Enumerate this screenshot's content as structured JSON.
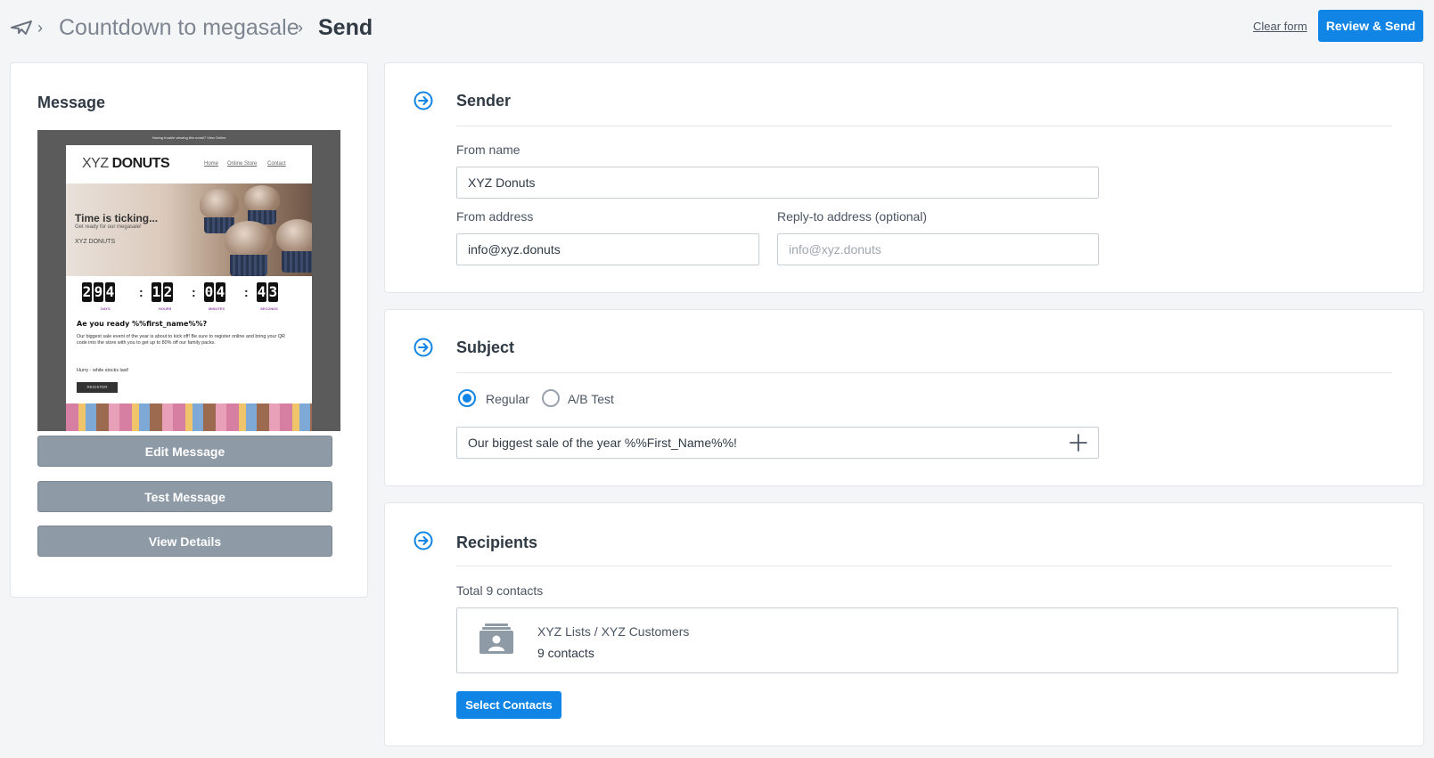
{
  "breadcrumb": {
    "parent": "Countdown to megasale",
    "current": "Send"
  },
  "header": {
    "clear_form": "Clear form",
    "review_send": "Review & Send"
  },
  "message": {
    "title": "Message",
    "preview": {
      "top_note": "Having trouble viewing this email? View Online",
      "logo_left": "XYZ ",
      "logo_right": "DONUTS",
      "nav": [
        "Home",
        "Online Store",
        "Contact"
      ],
      "hero_title": "Time is ticking...",
      "hero_sub": "Get ready for our megasale!",
      "hero_mini": "XYZ DONUTS",
      "countdown": {
        "days": "294",
        "hours": "12",
        "minutes": "04",
        "seconds": "43",
        "labels": [
          "DAYS",
          "HOURS",
          "MINUTES",
          "SECONDS"
        ]
      },
      "greeting": "Ae you ready %%first_name%%?",
      "paragraph": "Our biggest sale event of the year is about to kick off! Be sure to register online and bring your QR code into the store with you to get up to 80% off our family packs.",
      "paragraph2": "Hurry - while stocks last!",
      "register": "REGISTER"
    },
    "buttons": {
      "edit": "Edit Message",
      "test": "Test Message",
      "details": "View Details"
    }
  },
  "sender": {
    "title": "Sender",
    "from_name_label": "From name",
    "from_name_value": "XYZ Donuts",
    "from_address_label": "From address",
    "from_address_value": "info@xyz.donuts",
    "reply_to_label": "Reply-to address (optional)",
    "reply_to_placeholder": "info@xyz.donuts"
  },
  "subject": {
    "title": "Subject",
    "options": [
      "Regular",
      "A/B Test"
    ],
    "selected": "Regular",
    "value": "Our biggest sale of the year %%First_Name%%!"
  },
  "recipients": {
    "title": "Recipients",
    "total": "Total 9 contacts",
    "list_path": "XYZ Lists / XYZ Customers",
    "list_count": "9 contacts",
    "select_button": "Select Contacts"
  },
  "colors": {
    "accent": "#1185e6",
    "gray_button": "#8e9aa6",
    "background": "#f4f5f7"
  }
}
